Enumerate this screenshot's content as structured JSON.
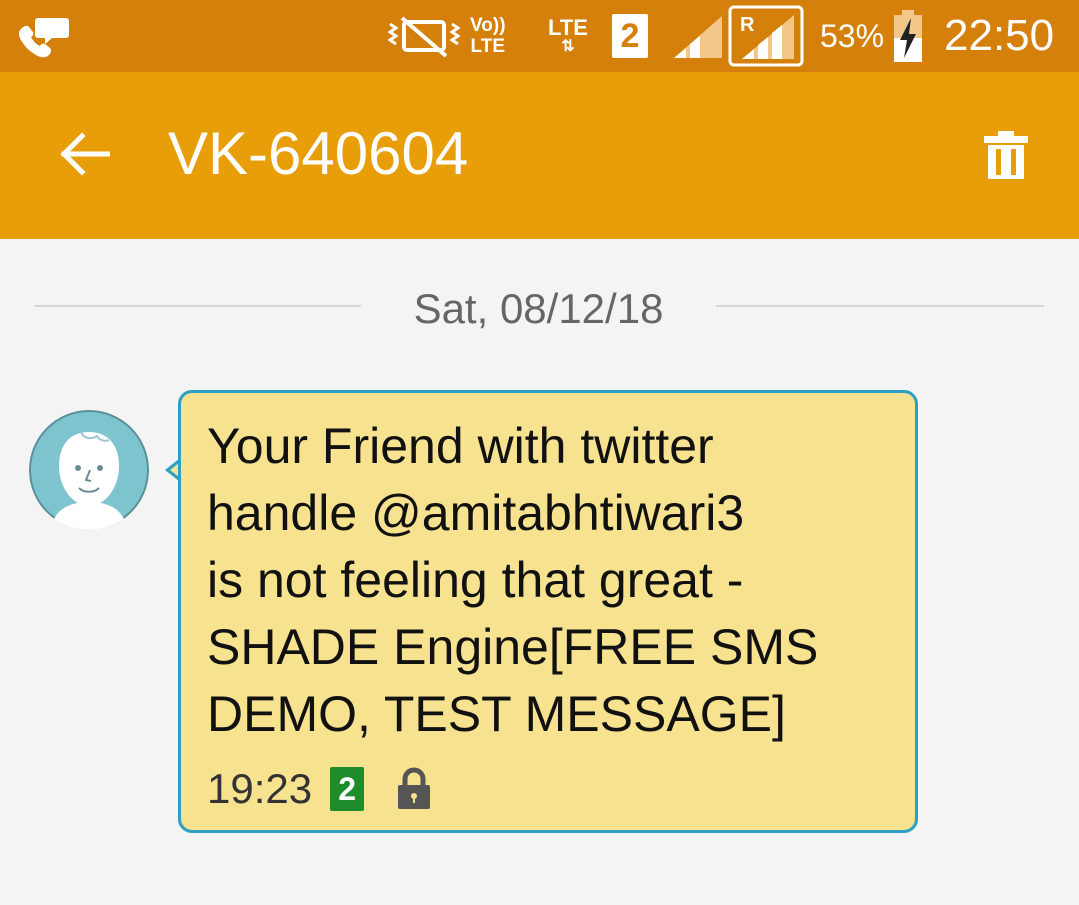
{
  "status_bar": {
    "icons": [
      "call-icon",
      "vibrate-icon",
      "volte-icon",
      "lte-icon",
      "sim2-icon",
      "signal-icon",
      "roaming-signal-icon",
      "battery-charging-icon"
    ],
    "volte_top": "Vo))",
    "volte_bottom": "LTE",
    "lte_label": "LTE",
    "lte_arrows": "⇅",
    "sim_number": "2",
    "roaming": "R",
    "battery_percent": "53%",
    "time": "22:50"
  },
  "toolbar": {
    "title": "VK-640604",
    "icons": [
      "back-arrow-icon",
      "trash-icon"
    ]
  },
  "conversation": {
    "date": "Sat, 08/12/18",
    "messages": [
      {
        "text": "Your Friend with twitter\nhandle @amitabhtiwari3\nis not feeling that great -\nSHADE Engine[FREE SMS\nDEMO, TEST MESSAGE]",
        "time": "19:23",
        "sim": "2",
        "locked": true
      }
    ]
  },
  "colors": {
    "status_bar": "#d5800b",
    "toolbar": "#e89e08",
    "background": "#f4f4f4",
    "bubble": "#f6e28f",
    "bubble_border": "#2c9fc4",
    "sim_badge": "#1e8c2a",
    "avatar": "#7ec4cf"
  }
}
